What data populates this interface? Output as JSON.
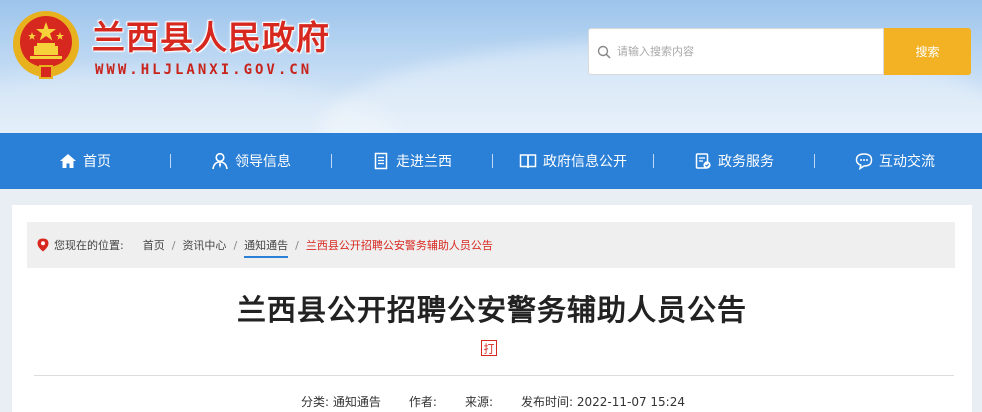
{
  "header": {
    "site_title": "兰西县人民政府",
    "site_url": "WWW.HLJLANXI.GOV.CN",
    "search_placeholder": "请输入搜索内容",
    "search_button": "搜索"
  },
  "nav": {
    "items": [
      {
        "label": "首页",
        "icon": "home-icon"
      },
      {
        "label": "领导信息",
        "icon": "person-icon"
      },
      {
        "label": "走进兰西",
        "icon": "document-icon"
      },
      {
        "label": "政府信息公开",
        "icon": "book-icon"
      },
      {
        "label": "政务服务",
        "icon": "service-icon"
      },
      {
        "label": "互动交流",
        "icon": "chat-icon"
      }
    ]
  },
  "breadcrumb": {
    "prefix": "您现在的位置:",
    "items": [
      "首页",
      "资讯中心",
      "通知通告",
      "兰西县公开招聘公安警务辅助人员公告"
    ]
  },
  "article": {
    "title": "兰西县公开招聘公安警务辅助人员公告",
    "print_glyph": "打",
    "meta": {
      "category_label": "分类:",
      "category_value": "通知通告",
      "author_label": "作者:",
      "author_value": "",
      "source_label": "来源:",
      "source_value": "",
      "date_label": "发布时间:",
      "date_value": "2022-11-07 15:24"
    }
  },
  "colors": {
    "brand_red": "#d7281f",
    "nav_blue": "#2a7fd6",
    "search_orange": "#f2b224"
  }
}
